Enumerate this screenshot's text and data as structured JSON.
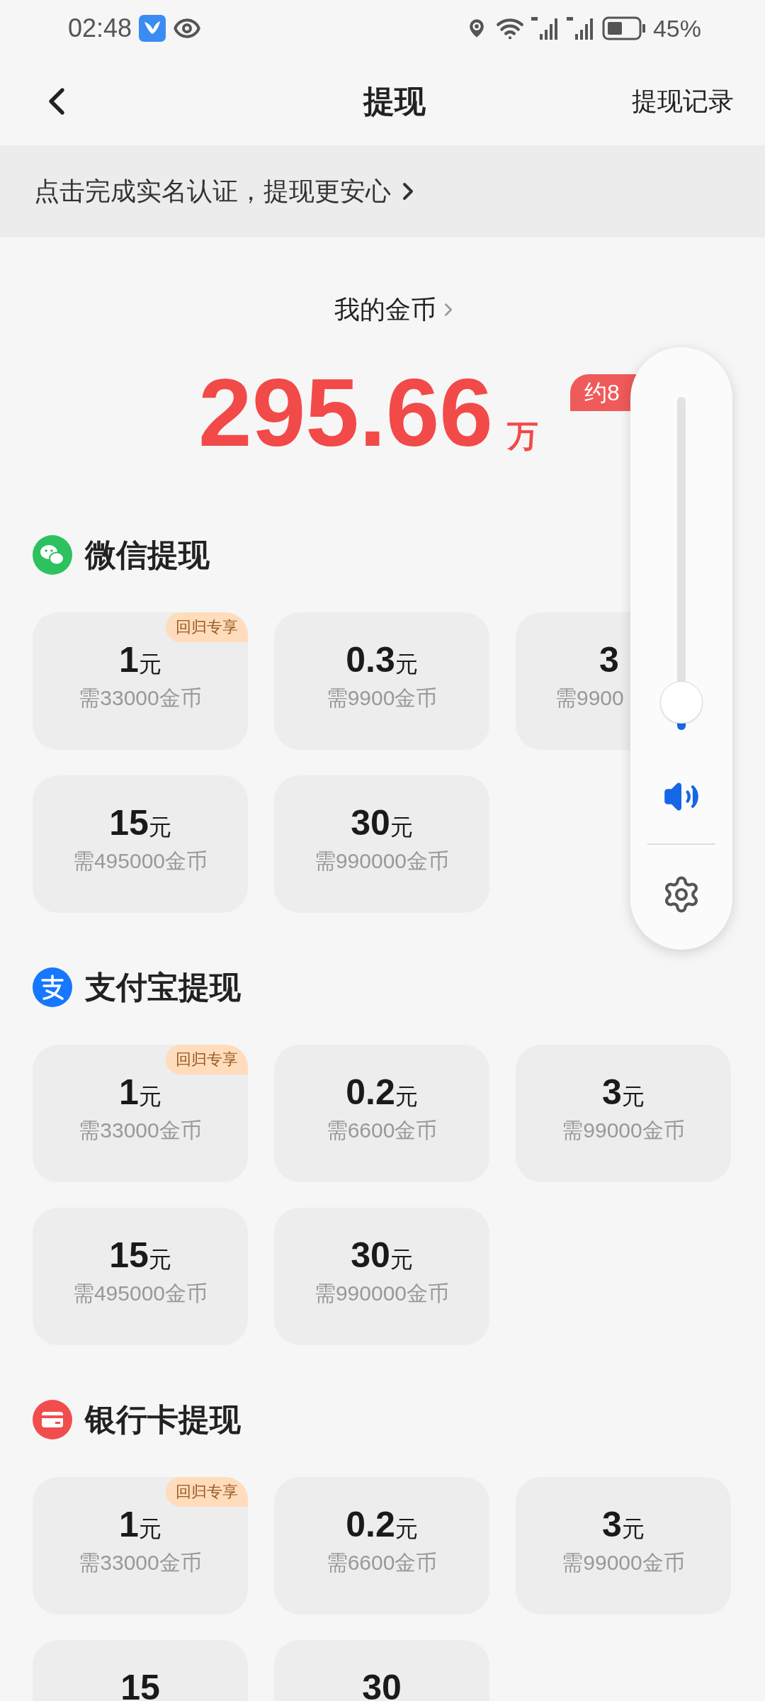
{
  "status_bar": {
    "time": "02:48",
    "battery": "45%"
  },
  "header": {
    "title": "提现",
    "action": "提现记录"
  },
  "banner": {
    "text": "点击完成实名认证，提现更安心"
  },
  "coins": {
    "label": "我的金币",
    "amount": "295.66",
    "unit": "万",
    "badge": "约8"
  },
  "sections": [
    {
      "kind": "wechat",
      "title": "微信提现",
      "options": [
        {
          "amount": "1",
          "unit": "元",
          "cost": "需33000金币",
          "tag": "回归专享"
        },
        {
          "amount": "0.3",
          "unit": "元",
          "cost": "需9900金币"
        },
        {
          "amount": "3",
          "cost": "需9900"
        },
        {
          "amount": "15",
          "unit": "元",
          "cost": "需495000金币"
        },
        {
          "amount": "30",
          "unit": "元",
          "cost": "需990000金币"
        }
      ]
    },
    {
      "kind": "alipay",
      "title": "支付宝提现",
      "options": [
        {
          "amount": "1",
          "unit": "元",
          "cost": "需33000金币",
          "tag": "回归专享"
        },
        {
          "amount": "0.2",
          "unit": "元",
          "cost": "需6600金币"
        },
        {
          "amount": "3",
          "unit": "元",
          "cost": "需99000金币"
        },
        {
          "amount": "15",
          "unit": "元",
          "cost": "需495000金币"
        },
        {
          "amount": "30",
          "unit": "元",
          "cost": "需990000金币"
        }
      ]
    },
    {
      "kind": "bank",
      "title": "银行卡提现",
      "options": [
        {
          "amount": "1",
          "unit": "元",
          "cost": "需33000金币",
          "tag": "回归专享"
        },
        {
          "amount": "0.2",
          "unit": "元",
          "cost": "需6600金币"
        },
        {
          "amount": "3",
          "unit": "元",
          "cost": "需99000金币"
        },
        {
          "amount": "15"
        },
        {
          "amount": "30"
        }
      ]
    }
  ],
  "volume": {
    "level": 0.05
  }
}
